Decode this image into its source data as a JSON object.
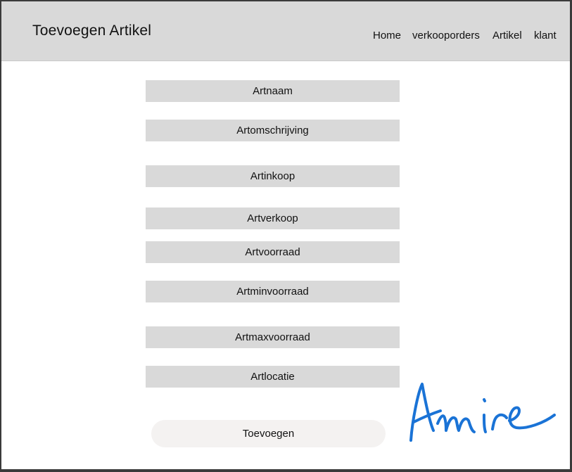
{
  "header": {
    "title": "Toevoegen Artikel",
    "nav": [
      {
        "label": "Home"
      },
      {
        "label": "verkooporders"
      },
      {
        "label": "Artikel"
      },
      {
        "label": "klant"
      }
    ]
  },
  "form": {
    "fields": [
      {
        "label": "Artnaam"
      },
      {
        "label": "Artomschrijving"
      },
      {
        "label": "Artinkoop"
      },
      {
        "label": "Artverkoop"
      },
      {
        "label": "Artvoorraad"
      },
      {
        "label": "Artminvoorraad"
      },
      {
        "label": "Artmaxvoorraad"
      },
      {
        "label": "Artlocatie"
      }
    ],
    "submit_label": "Toevoegen"
  },
  "signature": {
    "text": "Amire",
    "color": "#1a73d6"
  },
  "colors": {
    "header_bg": "#d9d9d9",
    "field_bg": "#d9d9d9",
    "button_bg": "#f4f2f1"
  }
}
